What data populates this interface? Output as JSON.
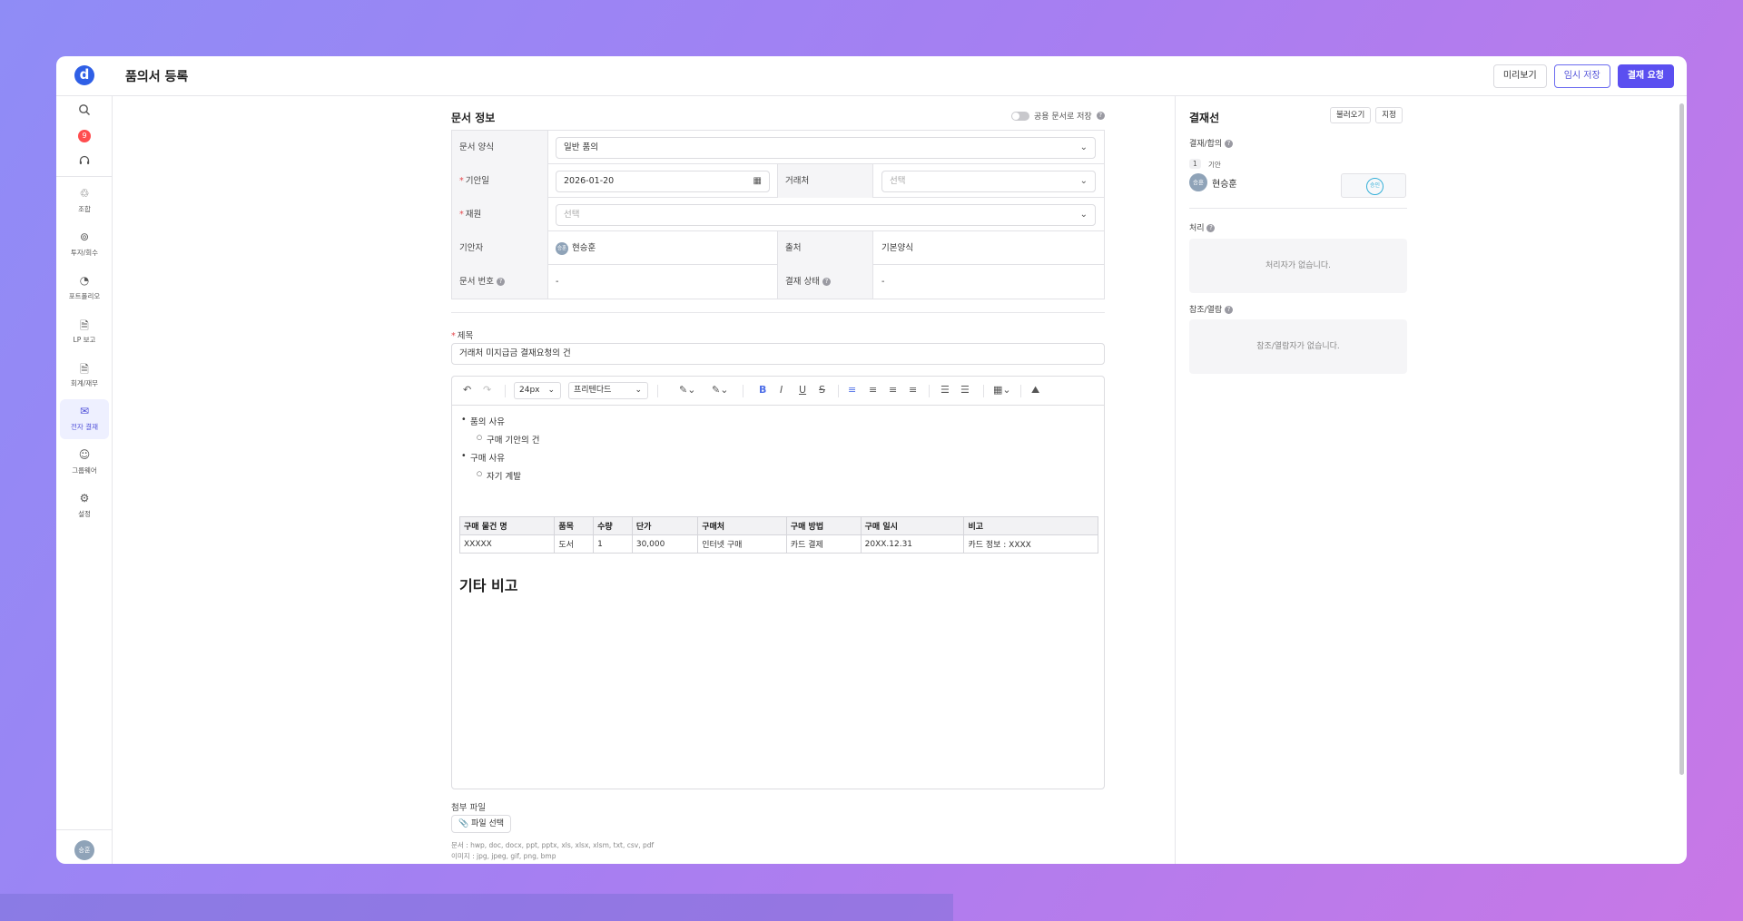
{
  "header": {
    "logo": "d",
    "title": "품의서 등록",
    "buttons": {
      "preview": "미리보기",
      "temp_save": "임시 저장",
      "request": "결재 요청"
    }
  },
  "sidebar": {
    "notification_count": "9",
    "items": [
      {
        "label": "조합",
        "icon": "union-icon"
      },
      {
        "label": "투자/회수",
        "icon": "investment-icon"
      },
      {
        "label": "포트폴리오",
        "icon": "portfolio-icon"
      },
      {
        "label": "LP 보고",
        "icon": "report-icon"
      },
      {
        "label": "회계/재무",
        "icon": "accounting-icon"
      },
      {
        "label": "전자 결재",
        "icon": "inbox-icon"
      },
      {
        "label": "그룹웨어",
        "icon": "groupware-icon"
      },
      {
        "label": "설정",
        "icon": "settings-icon"
      }
    ],
    "active_item": "전자 결재",
    "avatar": "승훈"
  },
  "doc_info": {
    "title": "문서 정보",
    "share_toggle": "공용 문서로 저장",
    "form_type_label": "문서 양식",
    "form_type_value": "일반 품의",
    "date_label": "기안일",
    "date_value": "2026-01-20",
    "vendor_label": "거래처",
    "vendor_placeholder": "선택",
    "fund_label": "재원",
    "fund_placeholder": "선택",
    "drafter_label": "기안자",
    "drafter_avatar": "승훈",
    "drafter_value": "현승훈",
    "source_label": "출처",
    "source_value": "기본양식",
    "doc_no_label": "문서 번호",
    "doc_no_value": "-",
    "status_label": "결재 상태",
    "status_value": "-"
  },
  "subject": {
    "label": "제목",
    "value": "거래처 미지급금 결재요청의 건"
  },
  "editor": {
    "font_size": "24px",
    "font_family": "프리텐다드",
    "content": {
      "b1": "품의 사유",
      "b1_sub": "구매 기안의 건",
      "b2": "구매 사유",
      "b2_sub": "자기 계발",
      "table_headers": [
        "구매 물건 명",
        "품목",
        "수량",
        "단가",
        "구매처",
        "구매 방법",
        "구매 일시",
        "비고"
      ],
      "table_rows": [
        [
          "XXXXX",
          "도서",
          "1",
          "30,000",
          "인터넷 구매",
          "카드 결제",
          "20XX.12.31",
          "카드 정보 : XXXX"
        ]
      ],
      "heading": "기타 비고"
    }
  },
  "attachment": {
    "label": "첨부 파일",
    "button": "파일 선택",
    "doc_hint": "문서 : hwp, doc, docx, ppt, pptx, xls, xlsx, xlsm, txt, csv, pdf",
    "img_hint": "이미지 : jpg, jpeg, gif, png, bmp"
  },
  "approval": {
    "title": "결재선",
    "load_btn": "불러오기",
    "assign_btn": "지정",
    "approve_label": "결재/합의",
    "step_no": "1",
    "step_type": "기안",
    "approver_avatar": "승훈",
    "approver_name": "현승훈",
    "stamp_text": "승인",
    "process_label": "처리",
    "process_empty": "처리자가 없습니다.",
    "ref_label": "참조/열람",
    "ref_empty": "참조/열람자가 없습니다."
  }
}
